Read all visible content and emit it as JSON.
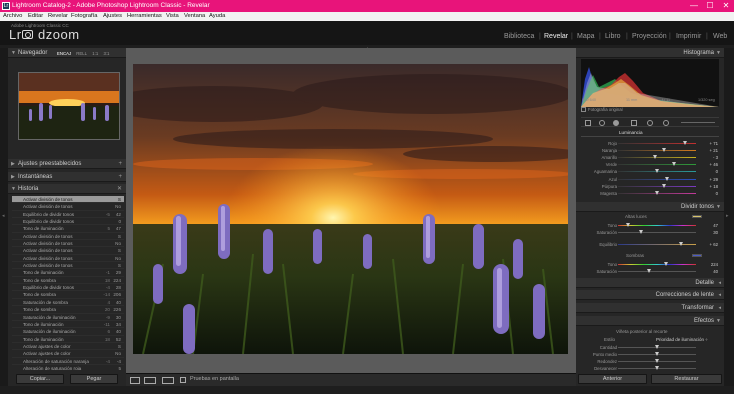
{
  "window": {
    "icon_text": "Lr",
    "title": "Lightroom Catalog-2 - Adobe Photoshop Lightroom Classic - Revelar",
    "controls": {
      "minimize": "—",
      "maximize": "☐",
      "close": "✕"
    }
  },
  "menu": [
    "Archivo",
    "Editar",
    "Revelar",
    "Fotografía",
    "Ajustes",
    "Herramientas",
    "Vista",
    "Ventana",
    "Ayuda"
  ],
  "identity": {
    "catalog_caption": "Adobe Lightroom Classic CC",
    "brand_prefix": "Lr",
    "brand_name": "dzoom"
  },
  "modules": [
    "Biblioteca",
    "Revelar",
    "Mapa",
    "Libro",
    "Proyección",
    "Imprimir",
    "Web"
  ],
  "module_separator": "|",
  "active_module": "Revelar",
  "left": {
    "navigator": {
      "title": "Navegador",
      "tabs": [
        "ENCAJ",
        "RELL",
        "1:1",
        "3:1"
      ]
    },
    "presets_title": "Ajustes preestablecidos",
    "snapshots_title": "Instantáneas",
    "history": {
      "title": "Historia",
      "rows": [
        {
          "label": "Activar división de tonos",
          "a": "",
          "b": "S"
        },
        {
          "label": "Activar división de tonos",
          "a": "",
          "b": "No"
        },
        {
          "label": "Equilibrio de dividir tonos",
          "a": "-5",
          "b": "42"
        },
        {
          "label": "Equilibrio de dividir tonos",
          "a": "",
          "b": "0"
        },
        {
          "label": "Tono de iluminación",
          "a": "5",
          "b": "47"
        },
        {
          "label": "Activar división de tonos",
          "a": "",
          "b": "S"
        },
        {
          "label": "Activar división de tonos",
          "a": "",
          "b": "No"
        },
        {
          "label": "Activar división de tonos",
          "a": "",
          "b": "S"
        },
        {
          "label": "Activar división de tonos",
          "a": "",
          "b": "No"
        },
        {
          "label": "Activar división de tonos",
          "a": "",
          "b": "S"
        },
        {
          "label": "Tono de iluminación",
          "a": "-1",
          "b": "29"
        },
        {
          "label": "Tono de sombra",
          "a": "18",
          "b": "224"
        },
        {
          "label": "Equilibrio de dividir tonos",
          "a": "-4",
          "b": "28"
        },
        {
          "label": "Tono de sombra",
          "a": "-14",
          "b": "206"
        },
        {
          "label": "Saturación de sombra",
          "a": "4",
          "b": "40"
        },
        {
          "label": "Tono de sombra",
          "a": "20",
          "b": "226"
        },
        {
          "label": "Saturación de iluminación",
          "a": "-9",
          "b": "30"
        },
        {
          "label": "Tono de iluminación",
          "a": "-11",
          "b": "34"
        },
        {
          "label": "Saturación de iluminación",
          "a": "6",
          "b": "40"
        },
        {
          "label": "Tono de iluminación",
          "a": "18",
          "b": "52"
        },
        {
          "label": "Activar ajustes de color",
          "a": "",
          "b": "S"
        },
        {
          "label": "Activar ajustes de color",
          "a": "",
          "b": "No"
        },
        {
          "label": "Alteración de saturación naranja",
          "a": "-4",
          "b": "-4"
        },
        {
          "label": "Alteración de saturación roja",
          "a": "",
          "b": "5"
        }
      ]
    },
    "buttons": {
      "copy": "Copiar...",
      "paste": "Pegar"
    }
  },
  "toolbar": {
    "softproof_label": "Pruebas en pantalla"
  },
  "right": {
    "histogram_title": "Histograma",
    "histogram_readout": [
      "ISO 640",
      "11 mm",
      "f / 11",
      "1/320 seg"
    ],
    "original_photo_label": "Fotografía original",
    "luminance_tab": "Luminancia",
    "hsl_rows": [
      {
        "label": "Rojo",
        "value": "+ 71",
        "pos": 0.86,
        "color": "#c23030"
      },
      {
        "label": "Naranja",
        "value": "+ 21",
        "pos": 0.6,
        "color": "#d27a1e"
      },
      {
        "label": "Amarillo",
        "value": "- 3",
        "pos": 0.48,
        "color": "#c9b21f"
      },
      {
        "label": "Verde",
        "value": "+ 46",
        "pos": 0.73,
        "color": "#2f9a3a"
      },
      {
        "label": "Aguamarina",
        "value": "0",
        "pos": 0.5,
        "color": "#2a9a9a"
      },
      {
        "label": "Azul",
        "value": "+ 29",
        "pos": 0.64,
        "color": "#2a4fc2"
      },
      {
        "label": "Púrpura",
        "value": "+ 18",
        "pos": 0.59,
        "color": "#7a3ac2"
      },
      {
        "label": "Magenta",
        "value": "0",
        "pos": 0.5,
        "color": "#c23a9a"
      }
    ],
    "split_title": "Dividir tonos",
    "highlights": {
      "title": "Altas luces",
      "tone_label": "Tono",
      "tone_value": "47",
      "tone_pos": 0.13,
      "sat_label": "Saturación",
      "sat_value": "30",
      "sat_pos": 0.3
    },
    "balance": {
      "label": "Equilibrio",
      "value": "+ 62",
      "pos": 0.81
    },
    "shadows": {
      "title": "Sombras",
      "tone_label": "Tono",
      "tone_value": "224",
      "tone_pos": 0.62,
      "sat_label": "Saturación",
      "sat_value": "40",
      "sat_pos": 0.4
    },
    "detail_title": "Detalle",
    "lens_title": "Correcciones de lente",
    "transform_title": "Transformar",
    "effects_title": "Efectos",
    "effects": {
      "vignette_title": "Viñeta posterior al recorte",
      "style_label": "Estilo",
      "style_value": "Prioridad de iluminación ÷",
      "rows": [
        "Cantidad",
        "Punto medio",
        "Redondez",
        "Desvanecer"
      ]
    },
    "buttons": {
      "previous": "Anterior",
      "reset": "Restaurar"
    }
  }
}
